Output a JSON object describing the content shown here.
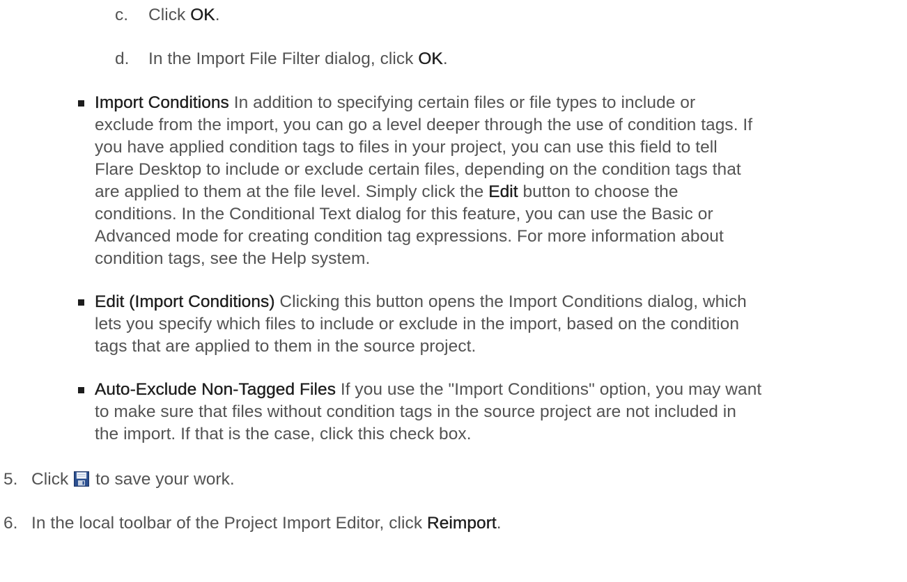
{
  "steps": {
    "c": {
      "marker": "c.",
      "prefix": "Click ",
      "bold": "OK",
      "suffix": "."
    },
    "d": {
      "marker": "d.",
      "prefix": "In the Import File Filter dialog, click ",
      "bold": "OK",
      "suffix": "."
    },
    "s5": {
      "marker": "5.",
      "prefix": "Click",
      "icon": "save-icon",
      "suffix": "to save your work."
    },
    "s6": {
      "marker": "6.",
      "prefix": "In the local toolbar of the Project Import Editor, click ",
      "bold": "Reimport",
      "suffix": "."
    }
  },
  "bullets": [
    {
      "term": "Import Conditions",
      "lines": [
        " In addition to specifying certain files or file types to include or",
        "exclude from the import, you can go a level deeper through the use of condition tags. If",
        "you have applied condition tags to files in your project, you can use this field to tell",
        "Flare Desktop to include or exclude certain files, depending on the condition tags that",
        "are applied to them at the file level. Simply click the ",
        "conditions. In the Conditional Text dialog for this feature, you can use the Basic or",
        "Advanced mode for creating condition tag expressions. For more information about",
        "condition tags, see the Help system."
      ],
      "inline_bold": "Edit",
      "inline_after": " button to choose the"
    },
    {
      "term": "Edit (Import Conditions)",
      "lines": [
        " Clicking this button opens the Import Conditions dialog, which",
        "lets you specify which files to include or exclude in the import, based on the condition",
        "tags that are applied to them in the source project."
      ]
    },
    {
      "term": "Auto-Exclude Non-Tagged Files",
      "lines": [
        " If you use the \"Import Conditions\" option, you may want",
        "to make sure that files without condition tags in the source project are not included in",
        "the import. If that is the case, click this check box."
      ]
    }
  ]
}
